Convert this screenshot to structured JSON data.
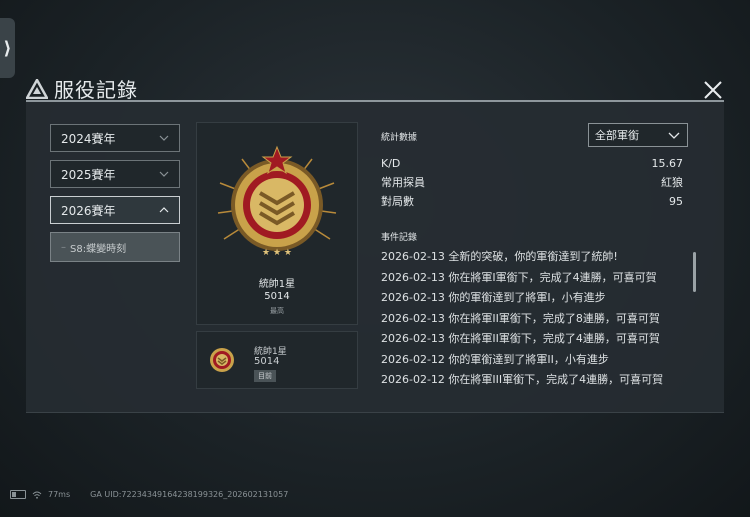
{
  "page": {
    "title": "服役記錄"
  },
  "seasons": [
    {
      "label": "2024賽年",
      "expanded": false
    },
    {
      "label": "2025賽年",
      "expanded": false
    },
    {
      "label": "2026賽年",
      "expanded": true
    }
  ],
  "sub_season": {
    "label": "S8:蝶變時刻"
  },
  "rank_card": {
    "name": "統帥1星",
    "score": "5014",
    "tag": "最高"
  },
  "current_card": {
    "name": "統帥1星",
    "score": "5014",
    "tag": "目前"
  },
  "stats": {
    "label": "統計數據",
    "filter": "全部軍銜",
    "rows": [
      {
        "key": "K/D",
        "value": "15.67"
      },
      {
        "key": "常用探員",
        "value": "紅狼"
      },
      {
        "key": "對局數",
        "value": "95"
      }
    ]
  },
  "events": {
    "label": "事件記錄",
    "items": [
      "2026-02-13 全新的突破，你的軍銜達到了統帥!",
      "2026-02-13 你在將軍I軍銜下，完成了4連勝，可喜可賀",
      "2026-02-13 你的軍銜達到了將軍I，小有進步",
      "2026-02-13 你在將軍II軍銜下，完成了8連勝，可喜可賀",
      "2026-02-13 你在將軍II軍銜下，完成了4連勝，可喜可賀",
      "2026-02-12 你的軍銜達到了將軍II，小有進步",
      "2026-02-12 你在將軍III軍銜下，完成了4連勝，可喜可賀"
    ]
  },
  "footer": {
    "ping": "77ms",
    "uid": "GA UID:72234349164238199326_202602131057"
  },
  "icons": {
    "side": "chevron-right-icon",
    "title": "triangle-logo-icon",
    "close": "close-icon",
    "rank": "rank-medal-icon"
  },
  "colors": {
    "accent": "#8e979c",
    "medal_gold": "#c9a24a",
    "medal_red": "#a01a22"
  }
}
